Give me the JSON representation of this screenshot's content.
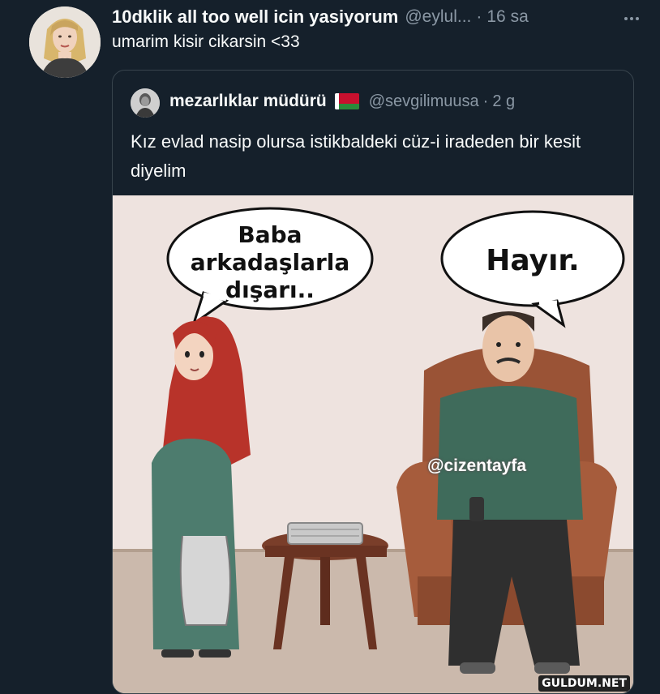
{
  "tweet": {
    "display_name": "10dklik all too well icin yasiyorum",
    "handle": "@eylul...",
    "separator": "·",
    "time": "16 sa",
    "text": "umarim kisir cikarsin <33"
  },
  "quote": {
    "display_name": "mezarlıklar müdürü",
    "flag": "flag-icon",
    "handle": "@sevgilimuusa",
    "separator": "·",
    "time": "2 g",
    "text": "Kız evlad nasip olursa istikbaldeki cüz-i iradeden bir kesit diyelim"
  },
  "media": {
    "bubble_left": [
      "Baba",
      "arkadaşlarla",
      "dışarı.."
    ],
    "bubble_right": "Hayır.",
    "watermark": "@cizentayfa",
    "site_logo": "GULDUM.NET"
  },
  "colors": {
    "background": "#15202b",
    "text_primary": "#f7f9f9",
    "text_secondary": "#8b98a5",
    "border": "#38444d"
  }
}
